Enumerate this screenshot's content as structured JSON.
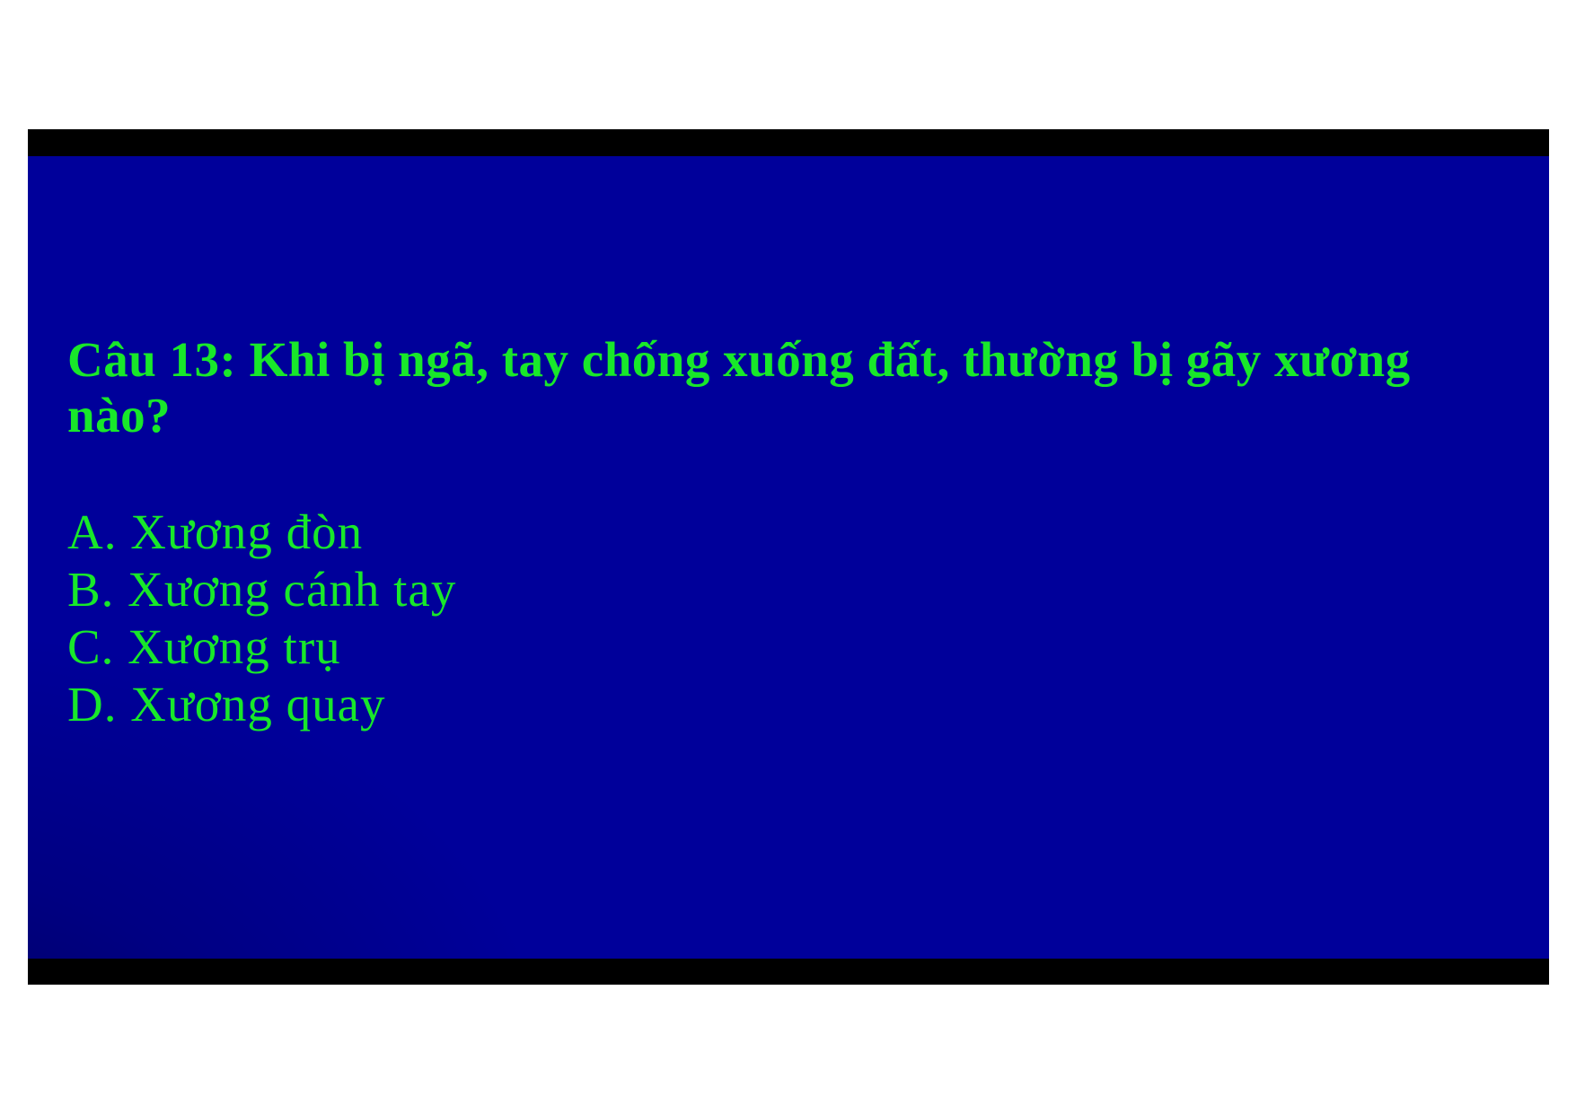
{
  "slide": {
    "question": "Câu 13: Khi bị ngã, tay chống xuống đất, thường bị gãy xương nào?",
    "answers": [
      "A. Xương đòn",
      "B. Xương cánh tay",
      "C. Xương trụ",
      "D. Xương quay"
    ]
  },
  "colors": {
    "background": "#00009a",
    "text": "#18e82a",
    "frame": "#000000",
    "page": "#ffffff"
  }
}
